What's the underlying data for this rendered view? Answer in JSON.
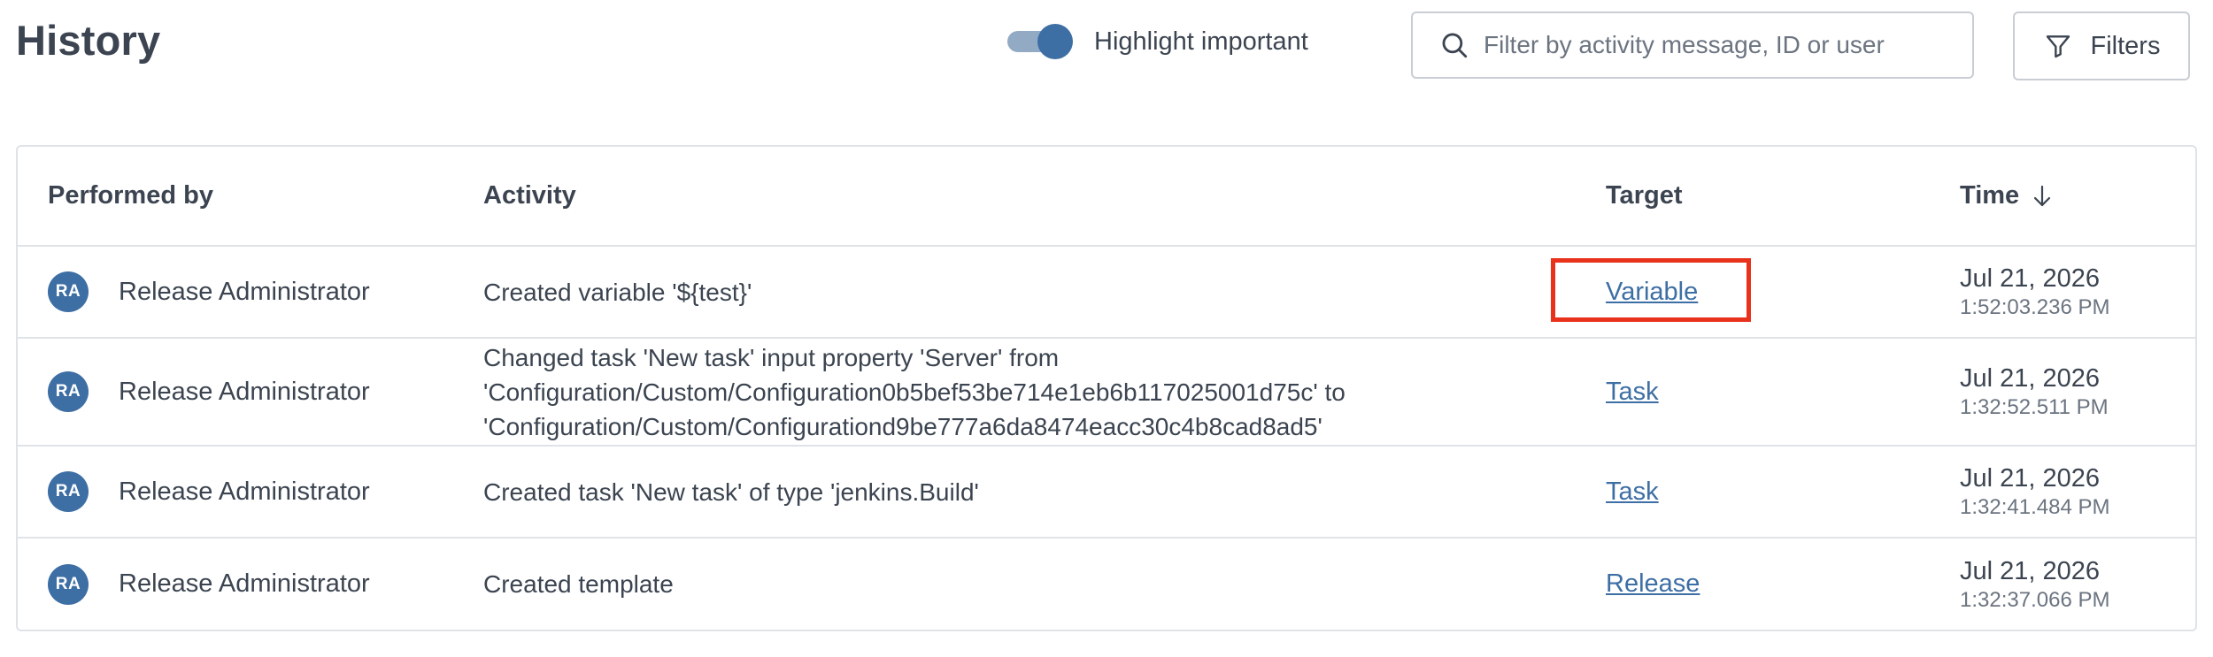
{
  "header": {
    "title": "History",
    "highlight_toggle": {
      "label": "Highlight important",
      "checked": true
    },
    "search": {
      "placeholder": "Filter by activity message, ID or user",
      "value": "",
      "icon": "search-icon"
    },
    "filters_button": {
      "label": "Filters",
      "icon": "filter-icon"
    }
  },
  "table": {
    "columns": {
      "performed_by": "Performed by",
      "activity": "Activity",
      "target": "Target",
      "time": "Time",
      "time_sort_icon": "arrow-down-icon"
    },
    "rows": [
      {
        "avatar": "RA",
        "user": "Release Administrator",
        "activity": "Created variable '${test}'",
        "target": "Variable",
        "date": "Jul 21, 2026",
        "time": "1:52:03.236 PM"
      },
      {
        "avatar": "RA",
        "user": "Release Administrator",
        "activity": "Changed task 'New task' input property 'Server' from 'Configuration/Custom/Configuration0b5bef53be714e1eb6b117025001d75c' to 'Configuration/Custom/Configurationd9be777a6da8474eacc30c4b8cad8ad5'",
        "target": "Task",
        "date": "Jul 21, 2026",
        "time": "1:32:52.511 PM"
      },
      {
        "avatar": "RA",
        "user": "Release Administrator",
        "activity": "Created task 'New task' of type 'jenkins.Build'",
        "target": "Task",
        "date": "Jul 21, 2026",
        "time": "1:32:41.484 PM"
      },
      {
        "avatar": "RA",
        "user": "Release Administrator",
        "activity": "Created template",
        "target": "Release",
        "date": "Jul 21, 2026",
        "time": "1:32:37.066 PM"
      }
    ]
  },
  "colors": {
    "accent": "#3d6ea4",
    "text": "#3b4450",
    "border": "#dfe3e8",
    "highlight": "#e8321c"
  }
}
